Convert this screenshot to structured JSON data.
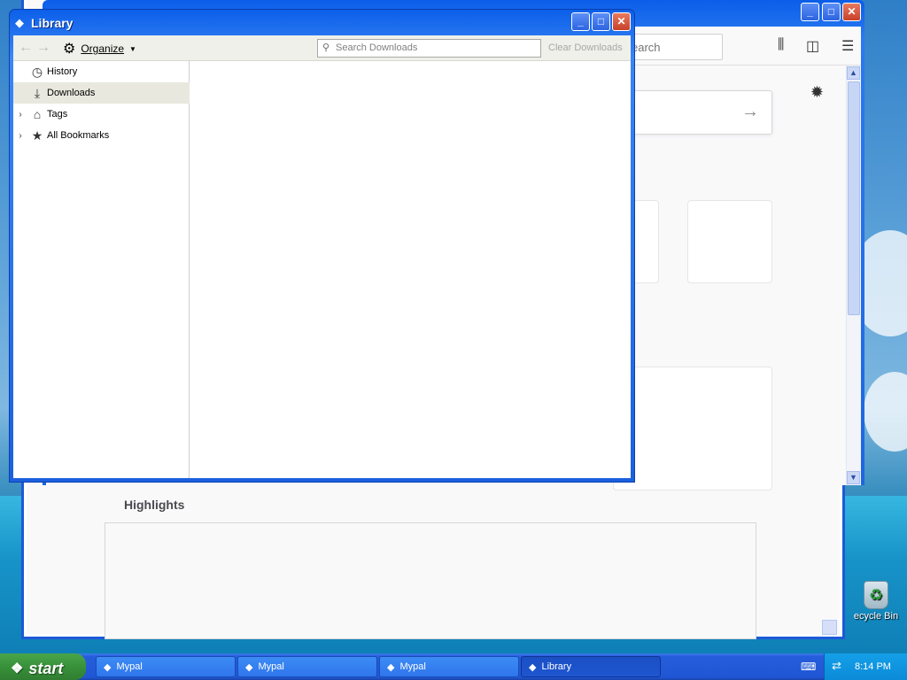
{
  "library": {
    "title": "Library",
    "toolbar": {
      "organize_label": "Organize",
      "search_placeholder": "Search Downloads",
      "clear_label": "Clear Downloads"
    },
    "sidebar": {
      "items": [
        {
          "label": "History",
          "icon": "clock-icon",
          "selected": false,
          "expandable": false
        },
        {
          "label": "Downloads",
          "icon": "download-icon",
          "selected": true,
          "expandable": false
        },
        {
          "label": "Tags",
          "icon": "tag-icon",
          "selected": false,
          "expandable": true
        },
        {
          "label": "All Bookmarks",
          "icon": "star-icon",
          "selected": false,
          "expandable": true
        }
      ]
    }
  },
  "browser": {
    "search_partial": "earch",
    "highlights_label": "Highlights"
  },
  "desktop": {
    "recycle_label": "ecycle Bin"
  },
  "taskbar": {
    "start_label": "start",
    "tasks": [
      {
        "label": "Mypal",
        "active": false
      },
      {
        "label": "Mypal",
        "active": false
      },
      {
        "label": "Mypal",
        "active": false
      },
      {
        "label": "Library",
        "active": true
      }
    ],
    "clock": "8:14 PM"
  },
  "colors": {
    "xp_blue": "#1c5ad8",
    "start_green": "#38913a",
    "tray_blue": "#0b8ad8",
    "selected_row": "#e8e8df"
  }
}
